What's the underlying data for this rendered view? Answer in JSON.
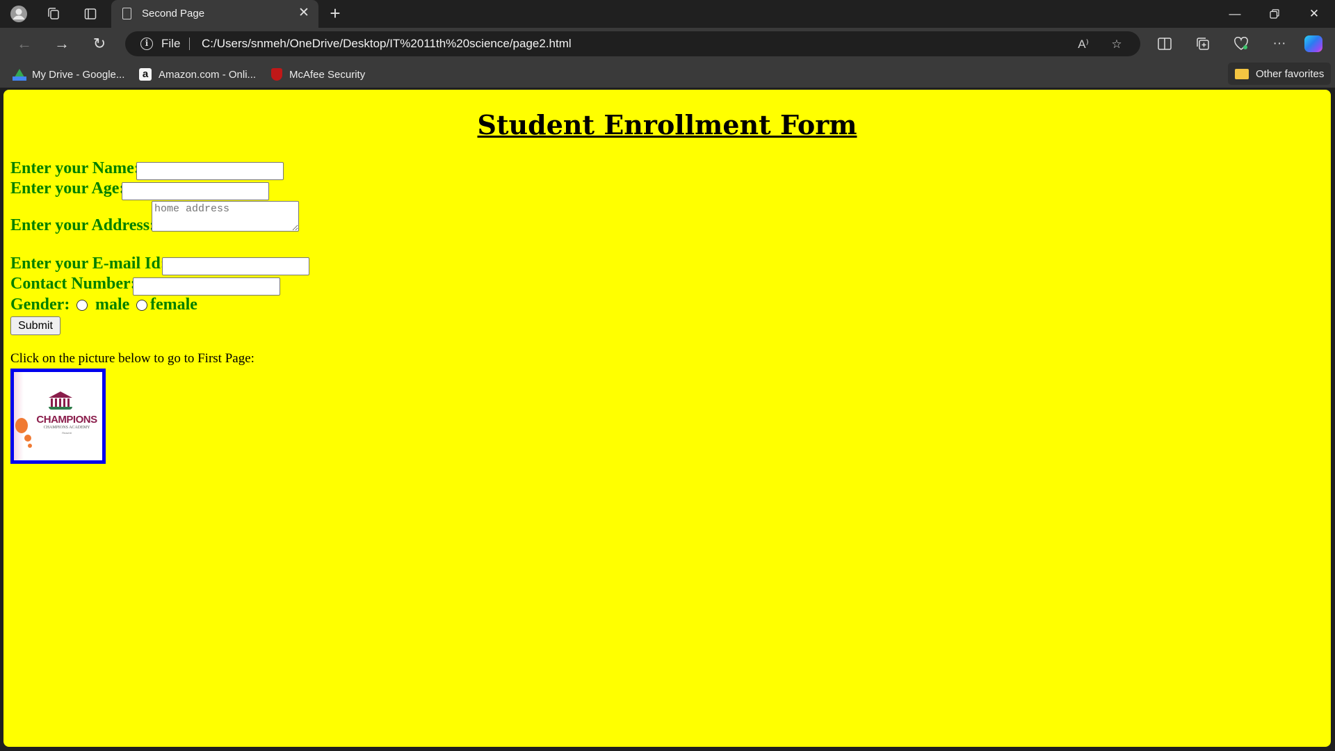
{
  "browser": {
    "tab": {
      "title": "Second Page",
      "icon": "document-icon"
    },
    "address": {
      "scheme": "File",
      "url": "C:/Users/snmeh/OneDrive/Desktop/IT%2011th%20science/page2.html"
    },
    "favorites": [
      {
        "label": "My Drive - Google...",
        "icon": "google-drive-icon"
      },
      {
        "label": "Amazon.com - Onli...",
        "icon": "amazon-icon"
      },
      {
        "label": "McAfee Security",
        "icon": "mcafee-icon"
      }
    ],
    "other_favorites": "Other favorites",
    "read_aloud_glyph": "A⁾"
  },
  "page": {
    "background": "#ffff00",
    "title": "Student Enrollment Form",
    "label_color": "#008000",
    "form": {
      "name_label": "Enter your Name:",
      "name_value": "",
      "age_label": "Enter your Age:",
      "age_value": "",
      "address_label": "Enter your Address:",
      "address_placeholder": "home address",
      "email_label": "Enter your E-mail Id:",
      "email_value": "",
      "contact_label": "Contact Number:",
      "contact_value": "",
      "gender_label": "Gender:",
      "gender_options": [
        "male",
        "female"
      ],
      "gender_selected": "",
      "submit_label": "Submit"
    },
    "hint": "Click on the picture below to go to First Page:",
    "logo": {
      "name": "CHAMPIONS",
      "subtitle": "CHAMPIONS ACADEMY",
      "tiny": "Reachit"
    }
  }
}
